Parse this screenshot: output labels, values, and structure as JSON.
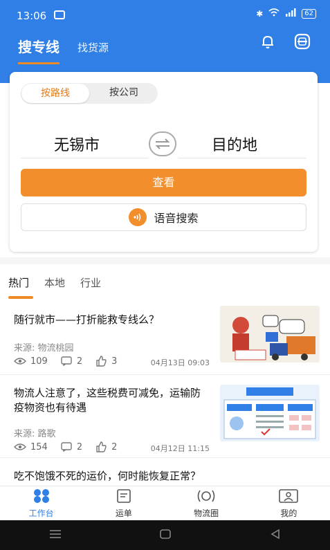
{
  "status": {
    "time": "13:06",
    "battery": "62"
  },
  "header": {
    "tab_main": "搜专线",
    "tab_sub": "找货源"
  },
  "search": {
    "seg_route": "按路线",
    "seg_company": "按公司",
    "from_city": "无锡市",
    "to_city": "目的地",
    "view_button": "查看",
    "voice_button": "语音搜索"
  },
  "news_tabs": [
    "热门",
    "本地",
    "行业"
  ],
  "news": [
    {
      "title": "随行就市——打折能救专线么？",
      "source": "来源: 物流桃园",
      "views": "109",
      "comments": "2",
      "likes": "3",
      "date": "04月13日 09:03"
    },
    {
      "title": "物流人注意了，这些税费可减免，运输防疫物资也有待遇",
      "source": "来源: 路歌",
      "views": "154",
      "comments": "2",
      "likes": "2",
      "date": "04月12日 11:15"
    },
    {
      "title": "吃不饱饿不死的运价，何时能恢复正常？"
    }
  ],
  "thumb2": {
    "banner": "财政公益税",
    "chips": [
      "减免",
      "不减",
      "减免",
      "不减"
    ]
  },
  "bottom_nav": [
    "工作台",
    "运单",
    "物流圈",
    "我的"
  ],
  "colors": {
    "brand_blue": "#2f7fe6",
    "accent_orange": "#f28e2b"
  }
}
